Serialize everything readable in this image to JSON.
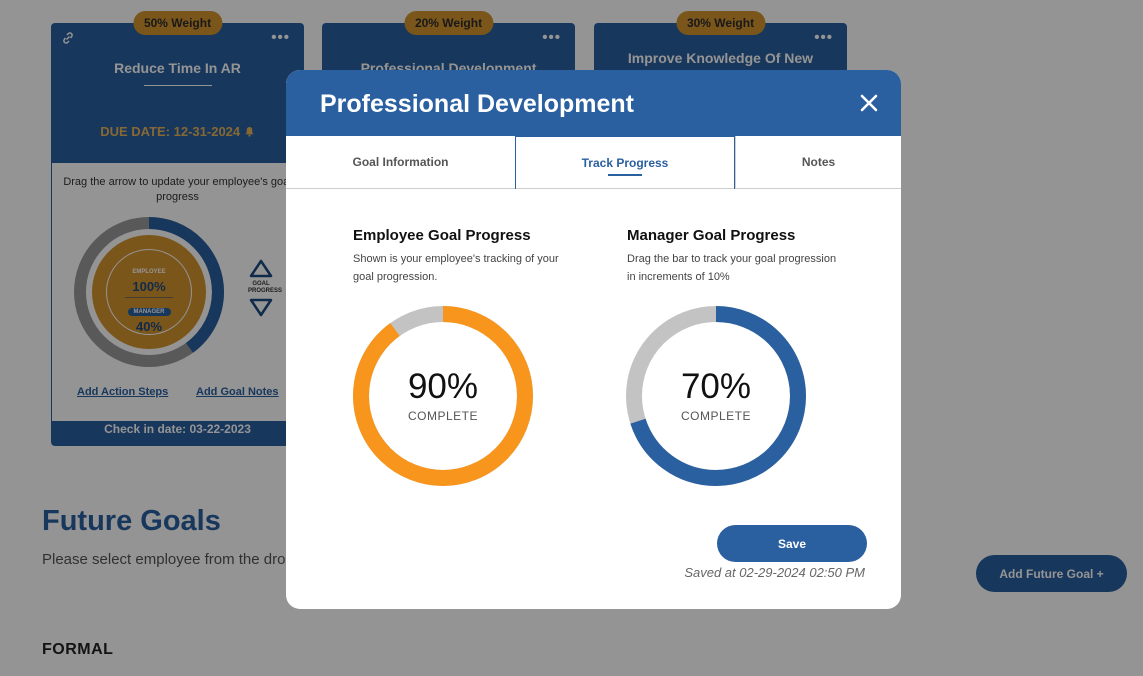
{
  "cards": [
    {
      "weight": "50% Weight",
      "title": "Reduce Time In AR",
      "due_date": "DUE DATE: 12-31-2024",
      "instruction": "Drag the arrow to update your employee's goal progress",
      "employee_label": "EMPLOYEE",
      "employee_pct": "100%",
      "manager_label": "MANAGER",
      "manager_pct": "40%",
      "employee_progress": 1.0,
      "manager_progress": 0.4,
      "arrows_label": "GOAL PROGRESS",
      "action_steps_link": "Add Action Steps",
      "goal_notes_link": "Add Goal Notes",
      "check_in": "Check in date: 03-22-2023"
    },
    {
      "weight": "20% Weight",
      "title": "Professional Development"
    },
    {
      "weight": "30% Weight",
      "title": "Improve Knowledge Of New"
    }
  ],
  "future": {
    "title": "Future Goals",
    "description": "Please select employee from the dropdown you would like to view.",
    "section_label": "FORMAL",
    "add_button": "Add Future Goal +"
  },
  "modal": {
    "title": "Professional Development",
    "tabs": [
      "Goal Information",
      "Track Progress",
      "Notes"
    ],
    "active_tab": "Track Progress",
    "employee": {
      "title": "Employee Goal Progress",
      "description": "Shown is your employee's tracking of your goal progression.",
      "percent_text": "90%",
      "percent_value": 0.9,
      "complete_label": "COMPLETE"
    },
    "manager": {
      "title": "Manager Goal Progress",
      "description": "Drag the bar to track your goal progression in increments of 10%",
      "percent_text": "70%",
      "percent_value": 0.7,
      "complete_label": "COMPLETE"
    },
    "save_label": "Save",
    "saved_at": "Saved at 02-29-2024 02:50 PM"
  },
  "colors": {
    "brand_blue": "#2a5fa0",
    "employee_orange": "#f7951d",
    "track_gray": "#c3c3c3",
    "weight_gold": "#d4952f"
  },
  "icons": [
    "link-icon",
    "more-icon",
    "bell-icon",
    "arrow-up-icon",
    "arrow-down-icon",
    "close-icon"
  ]
}
